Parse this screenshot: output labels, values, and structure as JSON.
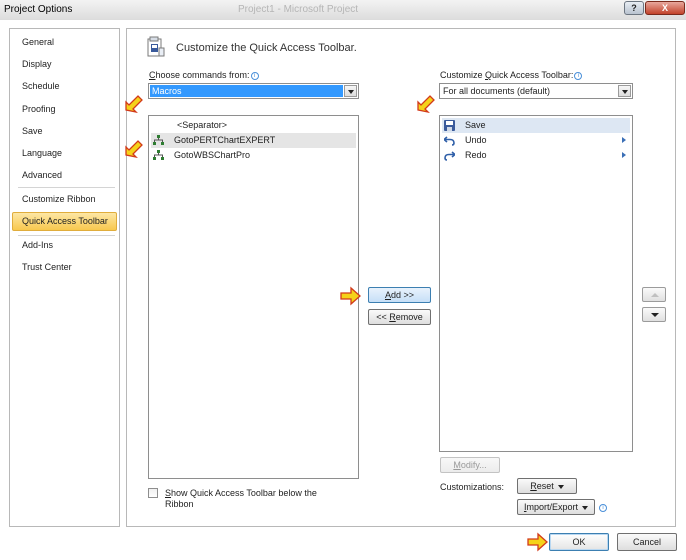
{
  "window": {
    "title": "Project Options",
    "background_title": "Project1  -  Microsoft Project",
    "help_label": "?",
    "close_label": "X"
  },
  "nav": {
    "items": [
      {
        "label": "General"
      },
      {
        "label": "Display"
      },
      {
        "label": "Schedule"
      },
      {
        "label": "Proofing"
      },
      {
        "label": "Save"
      },
      {
        "label": "Language"
      },
      {
        "label": "Advanced"
      },
      {
        "label": "Customize Ribbon"
      },
      {
        "label": "Quick Access Toolbar",
        "selected": true
      },
      {
        "label": "Add-Ins"
      },
      {
        "label": "Trust Center"
      }
    ]
  },
  "main": {
    "heading": "Customize the Quick Access Toolbar.",
    "choose_commands": {
      "label_prefix": "C",
      "label_rest": "hoose commands from:",
      "value": "Macros"
    },
    "commands_list": [
      {
        "label": "<Separator>",
        "icon": "separator"
      },
      {
        "label": "GotoPERTChartEXPERT",
        "icon": "macro-chart-icon",
        "highlighted": true
      },
      {
        "label": "GotoWBSChartPro",
        "icon": "macro-chart-icon"
      }
    ],
    "customize_qat": {
      "label_before": "Customize ",
      "label_ul": "Q",
      "label_after": "uick Access Toolbar:",
      "value": "For all documents (default)"
    },
    "qat_list": [
      {
        "label": "Save",
        "icon": "floppy-disk-icon",
        "selected": true
      },
      {
        "label": "Undo",
        "icon": "undo-icon",
        "submenu": true
      },
      {
        "label": "Redo",
        "icon": "redo-icon",
        "submenu": true
      }
    ],
    "add_button": {
      "ul": "A",
      "rest": "dd >>"
    },
    "remove_button": {
      "before": "<< ",
      "ul": "R",
      "rest": "emove"
    },
    "modify_button": {
      "ul": "M",
      "rest": "odify..."
    },
    "customizations_label": "Customizations:",
    "reset_button": {
      "ul": "R",
      "rest": "eset"
    },
    "import_export_button": {
      "ul": "I",
      "rest": "mport/Export"
    },
    "show_below": {
      "ul": "S",
      "line1_rest": "how Quick Access Toolbar below the",
      "line2": "Ribbon",
      "checked": false
    }
  },
  "footer": {
    "ok_label": "OK",
    "cancel_label": "Cancel"
  },
  "colors": {
    "selection_blue": "#3399ff",
    "nav_selected": "#f8c84e",
    "pointer_arrow": "#f5d21a"
  }
}
